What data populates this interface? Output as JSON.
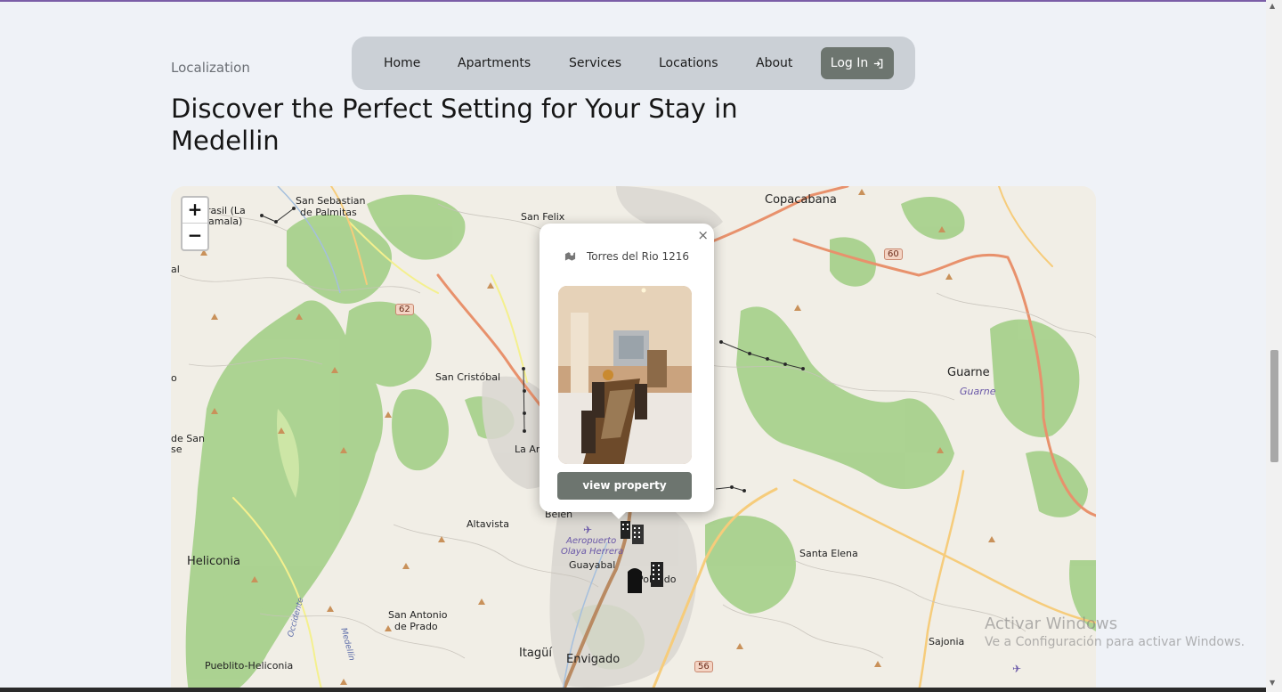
{
  "section": {
    "label": "Localization",
    "heading": "Discover the Perfect Setting for Your Stay in Medellin"
  },
  "nav": {
    "items": [
      {
        "label": "Home"
      },
      {
        "label": "Apartments"
      },
      {
        "label": "Services"
      },
      {
        "label": "Locations"
      },
      {
        "label": "About"
      }
    ],
    "login_label": "Log In",
    "login_icon": "login-arrow-icon"
  },
  "map": {
    "zoom_in": "+",
    "zoom_out": "−",
    "labels": {
      "copacabana": "Copacabana",
      "san_sebastian": "San Sebastian",
      "de_palmitas": "de Palmitas",
      "san_felix": "San Felix",
      "brasil": "rasil (La",
      "brasil2": "amala)",
      "san_cristobal": "San Cristóbal",
      "guarne": "Guarne",
      "guarne_ital": "Guarne",
      "la_am": "La An",
      "belen": "Belén",
      "altavista": "Altavista",
      "aeropuerto": "Aeropuerto",
      "olaya": "Olaya Herrera",
      "guayabal": "Guayabal",
      "poblado": "Poblado",
      "heliconia": "Heliconia",
      "santa_elena": "Santa Elena",
      "san_antonio": "San Antonio",
      "de_prado": "de Prado",
      "sajonia": "Sajonia",
      "pueblito": "Pueblito-Heliconia",
      "itagui": "Itagüí",
      "envigado": "Envigado",
      "de_san": "de San",
      "se": "se",
      "al": "al",
      "o": "o",
      "occidente": "Occidente",
      "medellin_river": "Medellín",
      "r62": "62",
      "r60": "60",
      "r56": "56"
    },
    "popup": {
      "title": "Torres del Rio 1216",
      "icon": "map-location-icon",
      "button": "view property",
      "close": "×"
    }
  },
  "watermark": {
    "line1": "Activar Windows",
    "line2": "Ve a Configuración para activar Windows."
  }
}
